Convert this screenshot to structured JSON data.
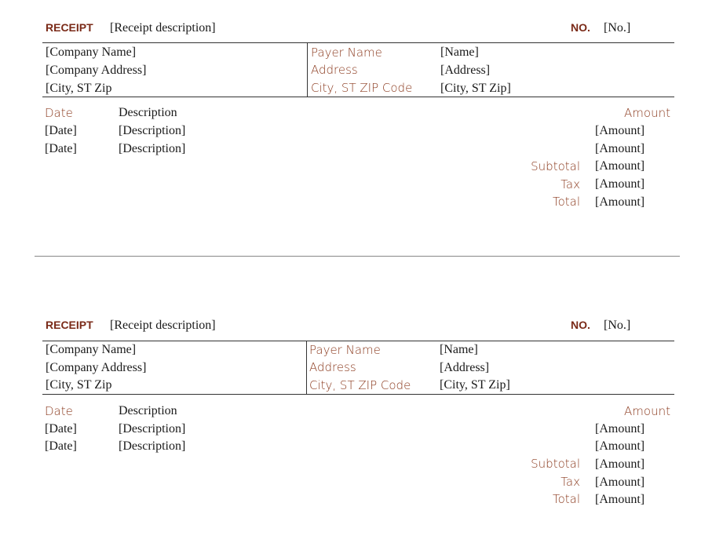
{
  "receipts": [
    {
      "title": "RECEIPT",
      "description": "[Receipt description]",
      "no_label": "NO.",
      "no_value": "[No.]",
      "company": {
        "name": "[Company Name]",
        "address": "[Company Address]",
        "city": "[City, ST  Zip"
      },
      "payer_labels": {
        "name": "Payer Name",
        "address": "Address",
        "city": "City, ST ZIP Code"
      },
      "payer_values": {
        "name": "[Name]",
        "address": "[Address]",
        "city": "[City, ST  Zip]"
      },
      "columns": {
        "date": "Date",
        "description": "Description",
        "amount": "Amount"
      },
      "items": [
        {
          "date": "[Date]",
          "description": "[Description]",
          "amount": "[Amount]"
        },
        {
          "date": "[Date]",
          "description": "[Description]",
          "amount": "[Amount]"
        }
      ],
      "totals": [
        {
          "label": "Subtotal",
          "value": "[Amount]"
        },
        {
          "label": "Tax",
          "value": "[Amount]"
        },
        {
          "label": "Total",
          "value": "[Amount]"
        }
      ]
    },
    {
      "title": "RECEIPT",
      "description": "[Receipt description]",
      "no_label": "NO.",
      "no_value": "[No.]",
      "company": {
        "name": "[Company Name]",
        "address": "[Company Address]",
        "city": "[City, ST  Zip"
      },
      "payer_labels": {
        "name": "Payer Name",
        "address": "Address",
        "city": "City, ST ZIP Code"
      },
      "payer_values": {
        "name": "[Name]",
        "address": "[Address]",
        "city": "[City, ST  Zip]"
      },
      "columns": {
        "date": "Date",
        "description": "Description",
        "amount": "Amount"
      },
      "items": [
        {
          "date": "[Date]",
          "description": "[Description]",
          "amount": "[Amount]"
        },
        {
          "date": "[Date]",
          "description": "[Description]",
          "amount": "[Amount]"
        }
      ],
      "totals": [
        {
          "label": "Subtotal",
          "value": "[Amount]"
        },
        {
          "label": "Tax",
          "value": "[Amount]"
        },
        {
          "label": "Total",
          "value": "[Amount]"
        }
      ]
    }
  ]
}
